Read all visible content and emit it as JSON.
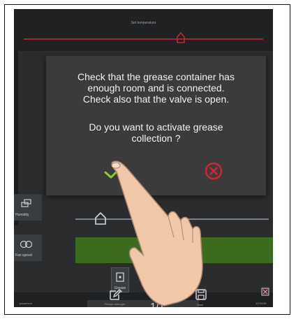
{
  "header": {
    "set_temperature_label": "Set temperature"
  },
  "dialog": {
    "message": "Check that the grease container has\nenough room and is connected.\nCheck also that the valve is open.",
    "question": "Do you want to activate grease\ncollection ?",
    "confirm_icon": "checkmark-icon",
    "cancel_icon": "close-circle-icon"
  },
  "side_buttons": [
    {
      "label": "Humidity",
      "icon": "humidity-icon"
    },
    {
      "label": "Fan speed",
      "icon": "fan-icon"
    }
  ],
  "small_button": {
    "label": "Grease coll.",
    "icon": "grease-collection-icon"
  },
  "bottom": {
    "recipe_label": "Recipe manager",
    "save_label": "Save",
    "page_counter": "1/1",
    "left_text": "pause/run",
    "clock": "12:34:56"
  },
  "colors": {
    "accent_red": "#a0242a",
    "accent_green": "#8ccc2c",
    "fan_bar_green": "#3c6d1f",
    "dialog_bg": "#3b3b3b"
  }
}
